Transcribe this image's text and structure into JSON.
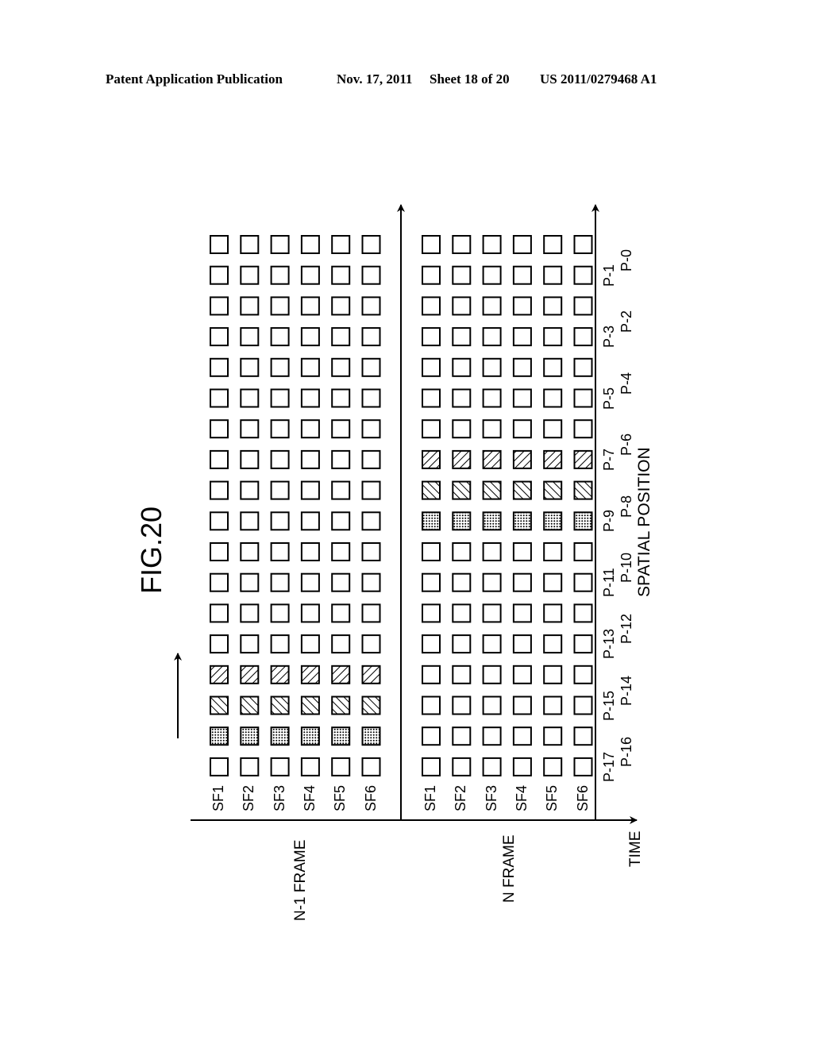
{
  "header": {
    "publication": "Patent Application Publication",
    "date": "Nov. 17, 2011",
    "sheet": "Sheet 18 of 20",
    "patent_number": "US 2011/0279468 A1"
  },
  "figure": {
    "title": "FIG.20",
    "time_axis_label": "TIME",
    "spatial_axis_label": "SPATIAL POSITION",
    "frames": [
      {
        "label": "N-1 FRAME",
        "subfields": [
          "SF1",
          "SF2",
          "SF3",
          "SF4",
          "SF5",
          "SF6"
        ],
        "patterned_cells": {
          "P-14": "hatch-forward",
          "P-15": "hatch-back",
          "P-16": "dots"
        }
      },
      {
        "label": "N FRAME",
        "subfields": [
          "SF1",
          "SF2",
          "SF3",
          "SF4",
          "SF5",
          "SF6"
        ],
        "patterned_cells": {
          "P-7": "hatch-forward",
          "P-8": "hatch-back",
          "P-9": "dots"
        }
      }
    ],
    "positions": [
      "P-0",
      "P-1",
      "P-2",
      "P-3",
      "P-4",
      "P-5",
      "P-6",
      "P-7",
      "P-8",
      "P-9",
      "P-10",
      "P-11",
      "P-12",
      "P-13",
      "P-14",
      "P-15",
      "P-16",
      "P-17"
    ],
    "motion_arrow": "up"
  }
}
